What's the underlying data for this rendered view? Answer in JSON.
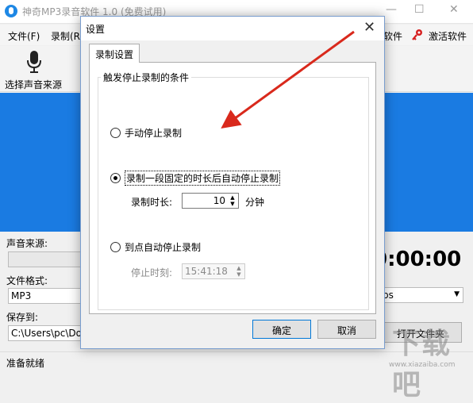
{
  "app": {
    "title": "神奇MP3录音软件 1.0 (免费试用)",
    "window_controls": [
      "—",
      "☐",
      "✕"
    ]
  },
  "menu": {
    "items": [
      "文件(F)",
      "录制(R"
    ],
    "right_items": [
      "软件",
      "激活软件"
    ]
  },
  "toolbar": {
    "source_label": "选择声音来源"
  },
  "main": {
    "source_label": "声音来源:",
    "format_label": "文件格式:",
    "format_value": "MP3",
    "save_label": "保存到:",
    "save_path": "C:\\Users\\pc\\Doc",
    "bitrate_suffix": "ps",
    "timer": "0:00:00",
    "open_folder_label": "打开文件夹"
  },
  "status": {
    "text": "准备就绪"
  },
  "watermark": {
    "text": "下载吧",
    "sub": "www.xiazaiba.com"
  },
  "dialog": {
    "title": "设置",
    "tab_label": "录制设置",
    "group_title": "触发停止录制的条件",
    "options": {
      "manual": "手动停止录制",
      "duration": "录制一段固定的时长后自动停止录制",
      "at_time": "到点自动停止录制"
    },
    "selected_option": "duration",
    "duration_label": "录制时长:",
    "duration_value": "10",
    "duration_unit": "分钟",
    "stop_time_label": "停止时刻:",
    "stop_time_value": "15:41:18",
    "ok_label": "确定",
    "cancel_label": "取消"
  },
  "colors": {
    "banner": "#1a7be2",
    "arrow": "#d9291c",
    "dialog_border": "#7a9ecf"
  }
}
